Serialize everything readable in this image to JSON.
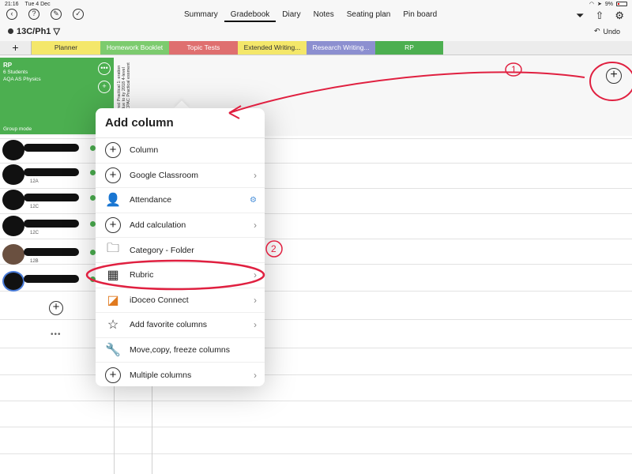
{
  "status": {
    "time": "21:16",
    "date": "Tue 4 Dec",
    "battery": "9%"
  },
  "nav": {
    "tabs": [
      {
        "label": "Summary",
        "active": false
      },
      {
        "label": "Gradebook",
        "active": true
      },
      {
        "label": "Diary",
        "active": false
      },
      {
        "label": "Notes",
        "active": false
      },
      {
        "label": "Seating plan",
        "active": false
      },
      {
        "label": "Pin board",
        "active": false
      }
    ]
  },
  "class_selector": {
    "label": "13C/Ph1 ▽"
  },
  "undo_label": "Undo",
  "categories": [
    {
      "label": "Planner",
      "color": "#f4e76a"
    },
    {
      "label": "Homework Booklet",
      "color": "#7ccb6e"
    },
    {
      "label": "Topic Tests",
      "color": "#df6f6f"
    },
    {
      "label": "Extended Writing...",
      "color": "#f4e76a"
    },
    {
      "label": "Research Writing...",
      "color": "#8c8fd0"
    },
    {
      "label": "RP",
      "color": "#4caf50"
    }
  ],
  "class_card": {
    "name": "RP",
    "students": "6 Students",
    "course": "AQA AS Physics",
    "group_mode": "Group mode"
  },
  "column_header": "ired Practical 1: eration due to ity 2018 4-level CPAC Practical essment",
  "students": [
    {
      "year": ""
    },
    {
      "year": "12A"
    },
    {
      "year": "12C"
    },
    {
      "year": "12C"
    },
    {
      "year": "12B"
    },
    {
      "year": ""
    }
  ],
  "popover": {
    "title": "Add column",
    "items": [
      {
        "label": "Column",
        "icon": "plus-circle-icon",
        "chevron": false
      },
      {
        "label": "Google Classroom",
        "icon": "plus-circle-icon",
        "chevron": true
      },
      {
        "label": "Attendance",
        "icon": "person-icon",
        "chevron": false
      },
      {
        "label": "Add calculation",
        "icon": "calculator-icon",
        "chevron": true
      },
      {
        "label": "Category - Folder",
        "icon": "folder-icon",
        "chevron": false
      },
      {
        "label": "Rubric",
        "icon": "grid-icon",
        "chevron": true
      },
      {
        "label": "iDoceo Connect",
        "icon": "app-icon",
        "chevron": true
      },
      {
        "label": "Add favorite columns",
        "icon": "star-icon",
        "chevron": true
      },
      {
        "label": "Move,copy, freeze columns",
        "icon": "wrench-icon",
        "chevron": false
      },
      {
        "label": "Multiple columns",
        "icon": "plus-gear-icon",
        "chevron": true
      }
    ]
  },
  "annotations": {
    "one": "1",
    "two": "2",
    "accent": "#e02040"
  }
}
